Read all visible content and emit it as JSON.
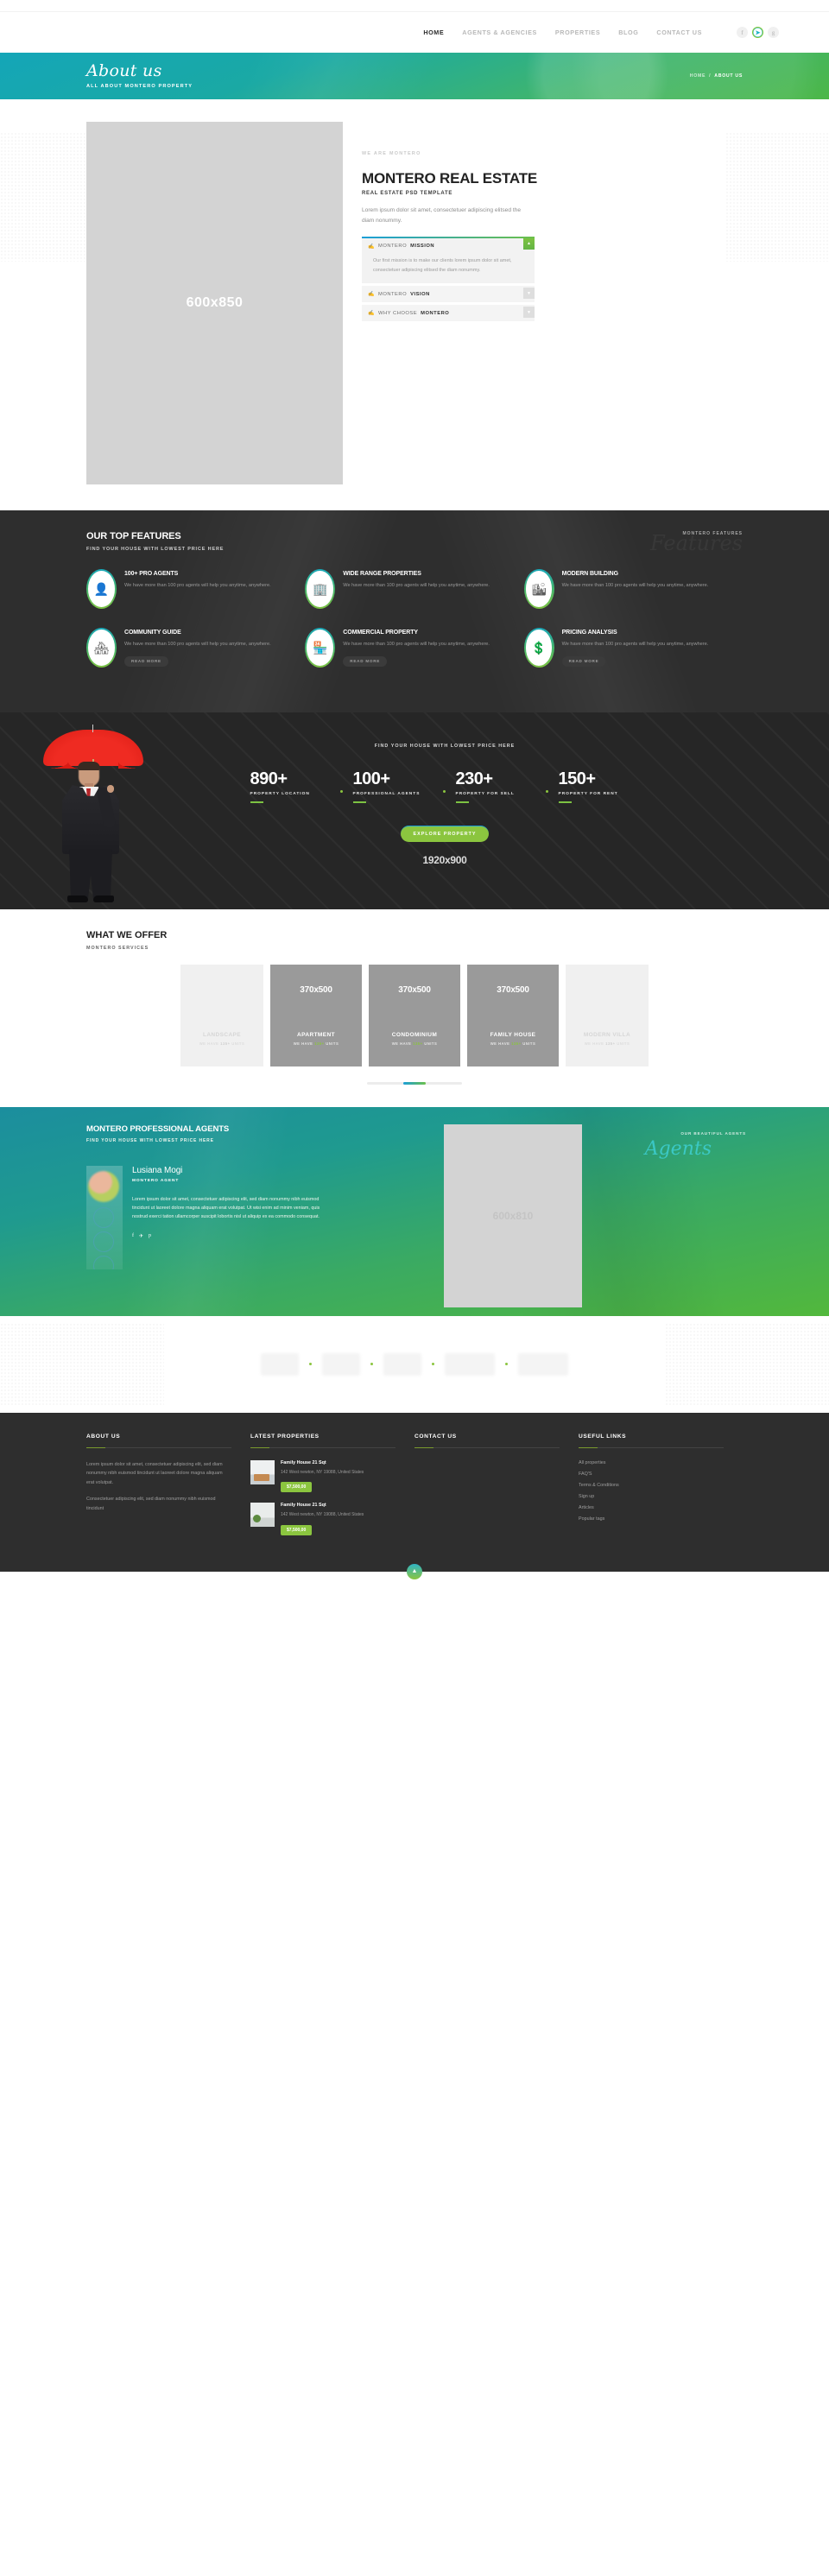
{
  "nav": {
    "links": [
      {
        "label": "HOME",
        "active": true
      },
      {
        "label": "AGENTS & AGENCIES",
        "active": false
      },
      {
        "label": "PROPERTIES",
        "active": false
      },
      {
        "label": "BLOG",
        "active": false
      },
      {
        "label": "CONTACT US",
        "active": false
      }
    ],
    "social": [
      {
        "name": "facebook-icon",
        "glyph": "f",
        "highlight": false
      },
      {
        "name": "twitter-icon",
        "glyph": "★",
        "highlight": true
      },
      {
        "name": "google-plus-icon",
        "glyph": "g",
        "highlight": false
      }
    ]
  },
  "banner": {
    "title": "About us",
    "subtitle": "ALL ABOUT MONTERO PROPERTY",
    "crumb_home": "HOME",
    "crumb_sep": "/",
    "crumb_current": "ABOUT US"
  },
  "intro": {
    "image_label": "600x850",
    "eyebrow": "WE ARE MONTERO",
    "title": "MONTERO REAL ESTATE",
    "subtitle": "REAL ESTATE PSD TEMPLATE",
    "lead": "Lorem ipsum dolor sit amet, consectetuer adipiscing elitsed the diam nonummy.",
    "accordion": [
      {
        "pre": "MONTERO",
        "strong": "MISSION",
        "open": true,
        "toggle": "▲",
        "body": "Our first mission is to make our clients lorem ipsum dolor sit amet, consectetuer adipiscing elitsed the diam nonummy."
      },
      {
        "pre": "MONTERO",
        "strong": "VISION",
        "open": false,
        "toggle": "▼",
        "body": ""
      },
      {
        "pre": "WHY CHOOSE",
        "strong": "MONTERO",
        "open": false,
        "toggle": "▼",
        "body": ""
      }
    ]
  },
  "features": {
    "title": "OUR TOP FEATURES",
    "subtitle": "FIND YOUR HOUSE WITH LOWEST PRICE HERE",
    "tag": "MONTERO FEATURES",
    "script": "Features",
    "readmore_label": "READ MORE",
    "items": [
      {
        "icon": "agent-chart-icon",
        "glyph": "὆4",
        "title": "100+ PRO AGENTS",
        "text": "We have more than 100 pro agents will help you anytime, anywhere."
      },
      {
        "icon": "building-icon",
        "glyph": "Ἶ2",
        "title": "WIDE RANGE PROPERTIES",
        "text": "We have more than 100 pro agents will help you anytime, anywhere."
      },
      {
        "icon": "city-skyline-icon",
        "glyph": "Ἵ9",
        "title": "MODERN BUILDING",
        "text": "We have more than 100 pro agents will help you anytime, anywhere."
      },
      {
        "icon": "community-icon",
        "glyph": "Ἵ8",
        "title": "COMMUNITY GUIDE",
        "text": "We have more than 100 pro agents will help you anytime, anywhere."
      },
      {
        "icon": "shop-house-icon",
        "glyph": "ἾA",
        "title": "COMMERCIAL PROPERTY",
        "text": "We have more than 100 pro agents will help you anytime, anywhere."
      },
      {
        "icon": "price-tag-hand-icon",
        "glyph": "Ὃ2",
        "title": "PRICING ANALYSIS",
        "text": "We have more than 100 pro agents will help you anytime, anywhere."
      }
    ]
  },
  "stats": {
    "subtitle": "FIND YOUR HOUSE WITH LOWEST PRICE HERE",
    "items": [
      {
        "num": "890+",
        "label": "PROPERTY LOCATION"
      },
      {
        "num": "100+",
        "label": "PROFESSIONAL AGENTS"
      },
      {
        "num": "230+",
        "label": "PROPERTY FOR SELL"
      },
      {
        "num": "150+",
        "label": "PROPERTY FOR RENT"
      }
    ],
    "cta": "EXPLORE PROPERTY",
    "dimension": "1920x900"
  },
  "offer": {
    "title": "WHAT WE OFFER",
    "subtitle": "MONTERO SERVICES",
    "cards": [
      {
        "name": "LANDSCAPE",
        "dim": "",
        "units_pre": "WE HAVE ",
        "units_num": "135+",
        "units_post": " UNITS",
        "side": true
      },
      {
        "name": "APARTMENT",
        "dim": "370x500",
        "units_pre": "WE HAVE ",
        "units_num": "135+",
        "units_post": " UNITS",
        "side": false
      },
      {
        "name": "CONDOMINIUM",
        "dim": "370x500",
        "units_pre": "WE HAVE ",
        "units_num": "135+",
        "units_post": " UNITS",
        "side": false
      },
      {
        "name": "FAMILY HOUSE",
        "dim": "370x500",
        "units_pre": "WE HAVE ",
        "units_num": "135+",
        "units_post": " UNITS",
        "side": false
      },
      {
        "name": "MODERN VILLA",
        "dim": "",
        "units_pre": "WE HAVE ",
        "units_num": "135+",
        "units_post": " UNITS",
        "side": true
      }
    ]
  },
  "agents": {
    "title": "MONTERO PROFESSIONAL AGENTS",
    "subtitle": "FIND YOUR HOUSE WITH LOWEST PRICE HERE",
    "name": "Lusiana Mogi",
    "role": "MONTERO AGENT",
    "bio": "Lorem ipsum dolor sit amet, consectetuer adipiscing elit, sed diam nonummy nibh euismod tincidunt ut laoreet dolore magna aliquam erat volutpat. Ut wisi enim ad minim veniam, quis nostrud exerci tation ullamcorper suscipit lobortis nisl ut aliquip ex ea commodo consequat.",
    "social": [
      {
        "name": "facebook-icon",
        "glyph": "f"
      },
      {
        "name": "twitter-icon",
        "glyph": "✈"
      },
      {
        "name": "pinterest-icon",
        "glyph": "p"
      }
    ],
    "image_label": "600x810",
    "tag": "OUR BEAUTIFUL AGENTS",
    "script": "Agents"
  },
  "footer": {
    "about": {
      "heading": "ABOUT US",
      "p1": "Lorem ipsum dolor sit amet, consectetuer adipiscing elit, sed diam nonummy nibh euismod tincidunt ut laoreet dolore magna aliquam erat volutpat.",
      "p2": "Consectetuer adipiscing elit, sed diam nonummy nibh euismod tincidunt"
    },
    "latest": {
      "heading": "LATEST PROPERTIES",
      "items": [
        {
          "name": "Family House 21 Sqt",
          "address": "142 West newton, NY 19088, United States",
          "price": "$7,500,00"
        },
        {
          "name": "Family House 21 Sqt",
          "address": "142 West newton, NY 19088, United States",
          "price": "$7,500,00"
        }
      ]
    },
    "contact": {
      "heading": "CONTACT US"
    },
    "useful": {
      "heading": "USEFUL LINKS",
      "links": [
        "All properties",
        "FAQ'S",
        "Terms & Conditions",
        "Sign up",
        "Articles",
        "Popular tags"
      ]
    },
    "to_top": "▲"
  }
}
